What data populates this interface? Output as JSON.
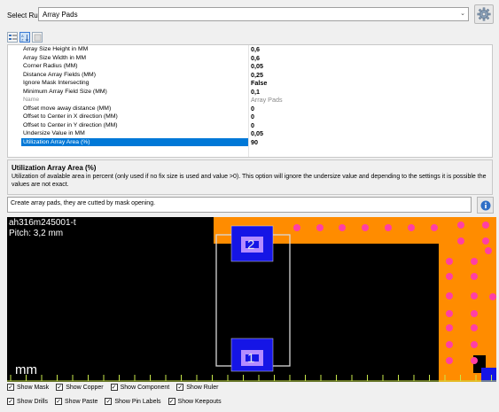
{
  "rule": {
    "label": "Select Rule",
    "selected": "Array Pads",
    "arrow": "⌄",
    "settings_icon": "gear-icon"
  },
  "toolbar": {
    "buttons": [
      "categorized-icon",
      "sort-alpha-icon",
      "property-pages-icon"
    ]
  },
  "properties": [
    {
      "name": "Array Size Height in MM",
      "value": "0,6",
      "state": "normal"
    },
    {
      "name": "Array Size Width in MM",
      "value": "0,6",
      "state": "normal"
    },
    {
      "name": "Corner Radius (MM)",
      "value": "0,05",
      "state": "normal"
    },
    {
      "name": "Distance Array Fields (MM)",
      "value": "0,25",
      "state": "normal"
    },
    {
      "name": "Ignore Mask Intersecting",
      "value": "False",
      "state": "normal"
    },
    {
      "name": "Minimum Array Field Size (MM)",
      "value": "0,1",
      "state": "normal"
    },
    {
      "name": "Name",
      "value": "Array Pads",
      "state": "dim"
    },
    {
      "name": "Offset move away distance (MM)",
      "value": "0",
      "state": "normal"
    },
    {
      "name": "Offset to Center in X direction (MM)",
      "value": "0",
      "state": "normal"
    },
    {
      "name": "Offset to Center in Y direction (MM)",
      "value": "0",
      "state": "normal"
    },
    {
      "name": "Undersize Value in MM",
      "value": "0,05",
      "state": "normal"
    },
    {
      "name": "Utilization Array Area (%)",
      "value": "90",
      "state": "selected"
    }
  ],
  "description": {
    "title": "Utilization Array Area (%)",
    "text": "Utilization of avalable area in percent (only used if no fix size is used and value >0). This option will ignore the undersize value and depending to the settings it is possible the values are not exact."
  },
  "status": {
    "text": "Create array pads, they are cutted by mask opening.",
    "info_icon": "info-icon"
  },
  "canvas": {
    "footprint": "ah316m245001-t",
    "pitch": "Pitch: 3,2 mm",
    "units": "mm",
    "pad_labels": [
      "2",
      "1"
    ],
    "colors": {
      "background": "#000000",
      "copper": "#ff8c00",
      "via": "#ff3fa5",
      "pad": "#1515e6",
      "paste": "#b48cff",
      "outline": "#d8d8d8",
      "ruler": "#c8e84a"
    }
  },
  "checkboxes": [
    [
      {
        "label": "Show Mask",
        "checked": true
      },
      {
        "label": "Show Copper",
        "checked": true
      },
      {
        "label": "Show Component",
        "checked": true
      },
      {
        "label": "Show Ruler",
        "checked": true
      }
    ],
    [
      {
        "label": "Show Drills",
        "checked": true
      },
      {
        "label": "Show Paste",
        "checked": true
      },
      {
        "label": "Show Pin Labels",
        "checked": true
      },
      {
        "label": "Show Keepouts",
        "checked": true
      }
    ]
  ]
}
